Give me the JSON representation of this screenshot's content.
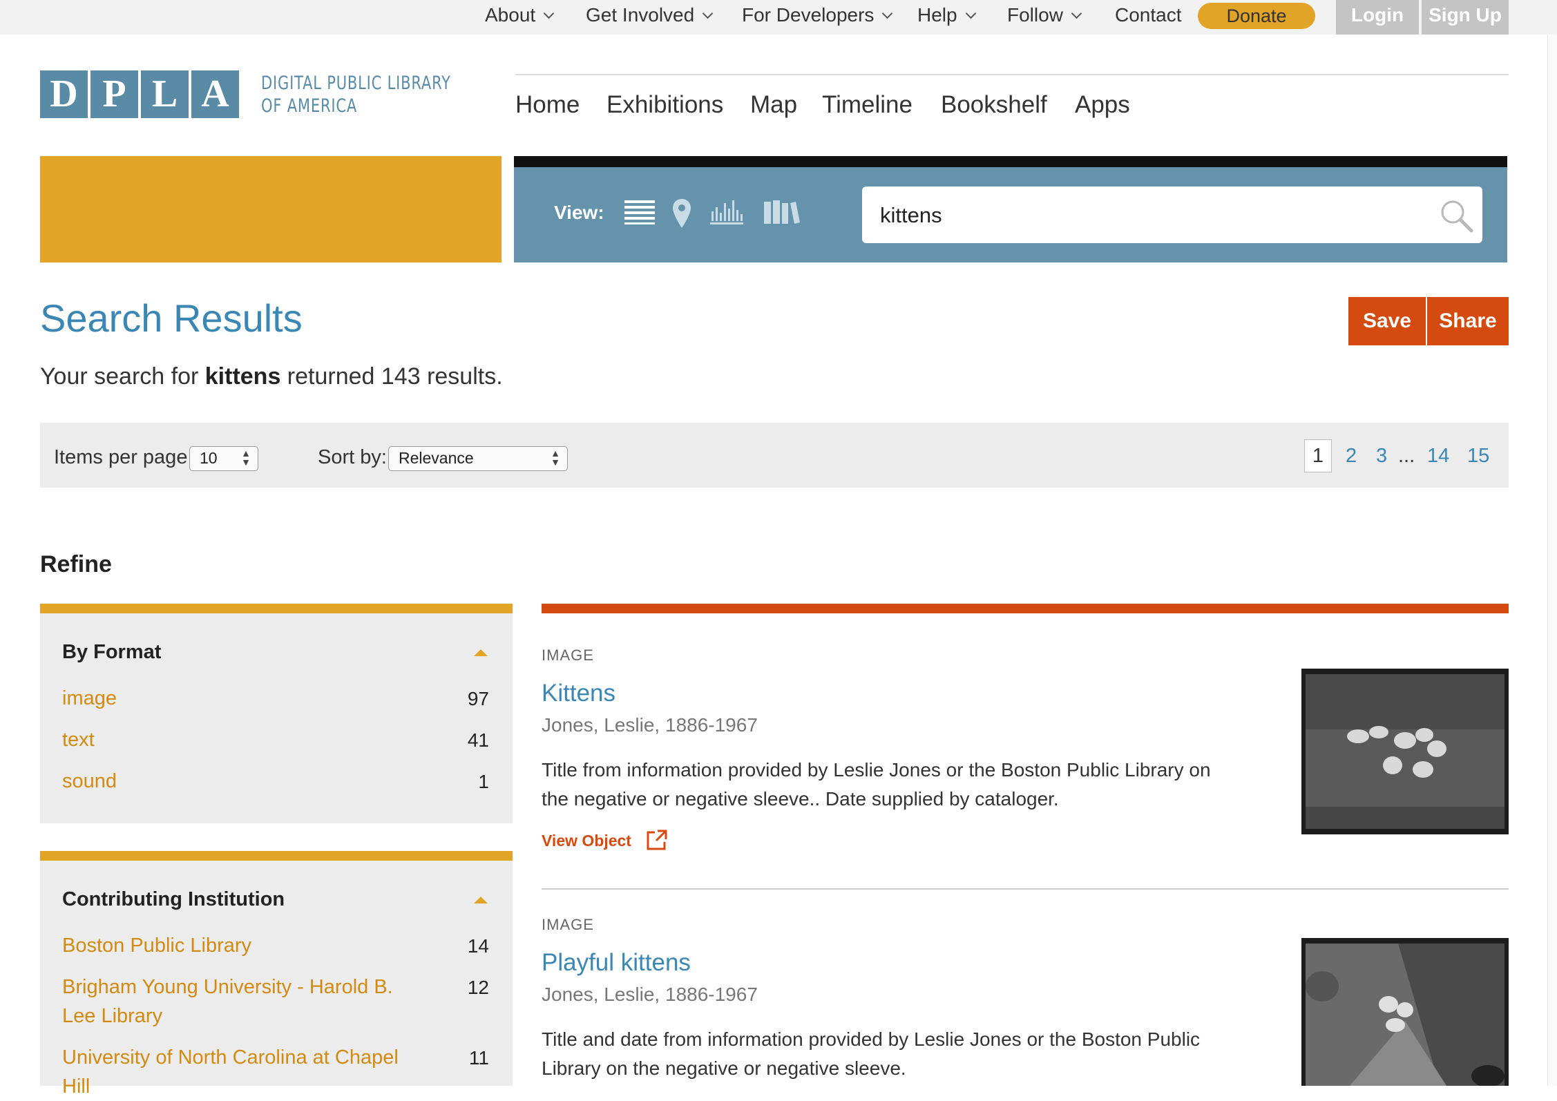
{
  "topbar": {
    "items": [
      {
        "label": "About"
      },
      {
        "label": "Get Involved"
      },
      {
        "label": "For Developers"
      },
      {
        "label": "Help"
      },
      {
        "label": "Follow"
      }
    ],
    "contact": "Contact",
    "donate": "Donate",
    "login": "Login",
    "signup": "Sign Up"
  },
  "logo": {
    "letters": [
      "D",
      "P",
      "L",
      "A"
    ],
    "line1": "DIGITAL PUBLIC LIBRARY",
    "line2": "OF AMERICA"
  },
  "nav": [
    "Home",
    "Exhibitions",
    "Map",
    "Timeline",
    "Bookshelf",
    "Apps"
  ],
  "search": {
    "view_label": "View:",
    "view_icons": [
      "list-view-icon",
      "map-view-icon",
      "timeline-view-icon",
      "bookshelf-view-icon"
    ],
    "query": "kittens"
  },
  "page": {
    "title": "Search Results",
    "save": "Save",
    "share": "Share",
    "summary_prefix": "Your search for ",
    "summary_term": "kittens",
    "summary_suffix": " returned 143 results."
  },
  "controls": {
    "items_label": "Items per page:",
    "items_value": "10",
    "sort_label": "Sort by:",
    "sort_value": "Relevance",
    "pages": [
      "1",
      "2",
      "3",
      "...",
      "14",
      "15"
    ]
  },
  "refine": {
    "title": "Refine",
    "facets": [
      {
        "title": "By Format",
        "items": [
          {
            "label": "image",
            "count": "97"
          },
          {
            "label": "text",
            "count": "41"
          },
          {
            "label": "sound",
            "count": "1"
          }
        ]
      },
      {
        "title": "Contributing Institution",
        "items": [
          {
            "label": "Boston Public Library",
            "count": "14"
          },
          {
            "label": "Brigham Young University - Harold B. Lee Library",
            "count": "12"
          },
          {
            "label": "University of North Carolina at Chapel Hill",
            "count": "11"
          }
        ]
      }
    ]
  },
  "results": [
    {
      "type": "IMAGE",
      "title": "Kittens",
      "creator": "Jones, Leslie, 1886-1967",
      "description": "Title from information provided by Leslie Jones or the Boston Public Library on the negative or negative sleeve.. Date supplied by cataloger.",
      "view": "View Object"
    },
    {
      "type": "IMAGE",
      "title": "Playful kittens",
      "creator": "Jones, Leslie, 1886-1967",
      "description": "Title and date from information provided by Leslie Jones or the Boston Public Library on the negative or negative sleeve."
    }
  ],
  "colors": {
    "brand_blue": "#5a8ba6",
    "gold": "#e2a427",
    "orange": "#d44a0f",
    "link_blue": "#3a86b4"
  }
}
